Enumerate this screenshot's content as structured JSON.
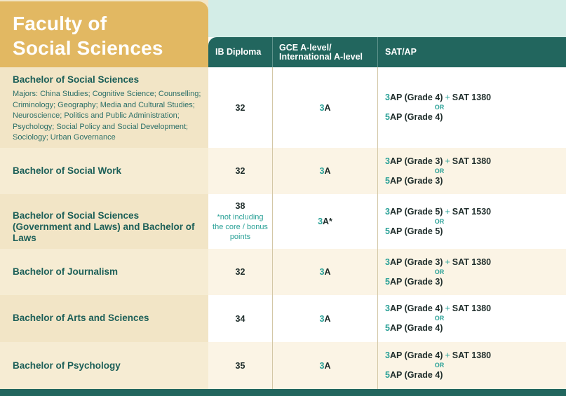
{
  "title": "Faculty of\nSocial Sciences",
  "headers": {
    "ib": "IB Diploma",
    "gce_line1": "GCE A-level/",
    "gce_line2": "International A-level",
    "sat": "SAT/AP"
  },
  "colors": {
    "teal": "#22665e",
    "gold": "#e2b862",
    "cream": "#f2e5c6",
    "accent": "#2aa197"
  },
  "rows": [
    {
      "program": "Bachelor of Social Sciences",
      "majors": "Majors: China Studies; Cognitive Science; Counselling; Criminology; Geography; Media and Cultural Studies; Neuroscience; Politics and Public Administration; Psychology; Social Policy and Social Development; Sociology; Urban Governance",
      "ib": "32",
      "gce_num": "3",
      "gce_grade": "A",
      "sat_a_num": "3",
      "sat_a": "AP (Grade 4)",
      "sat_plus": "+",
      "sat_a_sat": "SAT 1380",
      "sat_or": "OR",
      "sat_b_num": "5",
      "sat_b": "AP (Grade 4)"
    },
    {
      "program": "Bachelor of Social Work",
      "ib": "32",
      "gce_num": "3",
      "gce_grade": "A",
      "sat_a_num": "3",
      "sat_a": "AP (Grade 3)",
      "sat_plus": "+",
      "sat_a_sat": "SAT 1380",
      "sat_or": "OR",
      "sat_b_num": "5",
      "sat_b": "AP (Grade 3)"
    },
    {
      "program": "Bachelor of Social Sciences (Government and Laws) and Bachelor of Laws",
      "ib": "38",
      "ib_note": "*not including the core / bonus points",
      "gce_num": "3",
      "gce_grade": "A*",
      "sat_a_num": "3",
      "sat_a": "AP (Grade 5)",
      "sat_plus": "+",
      "sat_a_sat": "SAT 1530",
      "sat_or": "OR",
      "sat_b_num": "5",
      "sat_b": "AP (Grade 5)"
    },
    {
      "program": "Bachelor of Journalism",
      "ib": "32",
      "gce_num": "3",
      "gce_grade": "A",
      "sat_a_num": "3",
      "sat_a": "AP (Grade 3)",
      "sat_plus": "+",
      "sat_a_sat": "SAT 1380",
      "sat_or": "OR",
      "sat_b_num": "5",
      "sat_b": "AP (Grade 3)"
    },
    {
      "program": "Bachelor of Arts and Sciences",
      "ib": "34",
      "gce_num": "3",
      "gce_grade": "A",
      "sat_a_num": "3",
      "sat_a": "AP (Grade 4)",
      "sat_plus": "+",
      "sat_a_sat": "SAT 1380",
      "sat_or": "OR",
      "sat_b_num": "5",
      "sat_b": "AP (Grade 4)"
    },
    {
      "program": "Bachelor of Psychology",
      "ib": "35",
      "gce_num": "3",
      "gce_grade": "A",
      "sat_a_num": "3",
      "sat_a": "AP (Grade 4)",
      "sat_plus": "+",
      "sat_a_sat": "SAT 1380",
      "sat_or": "OR",
      "sat_b_num": "5",
      "sat_b": "AP (Grade 4)"
    }
  ]
}
